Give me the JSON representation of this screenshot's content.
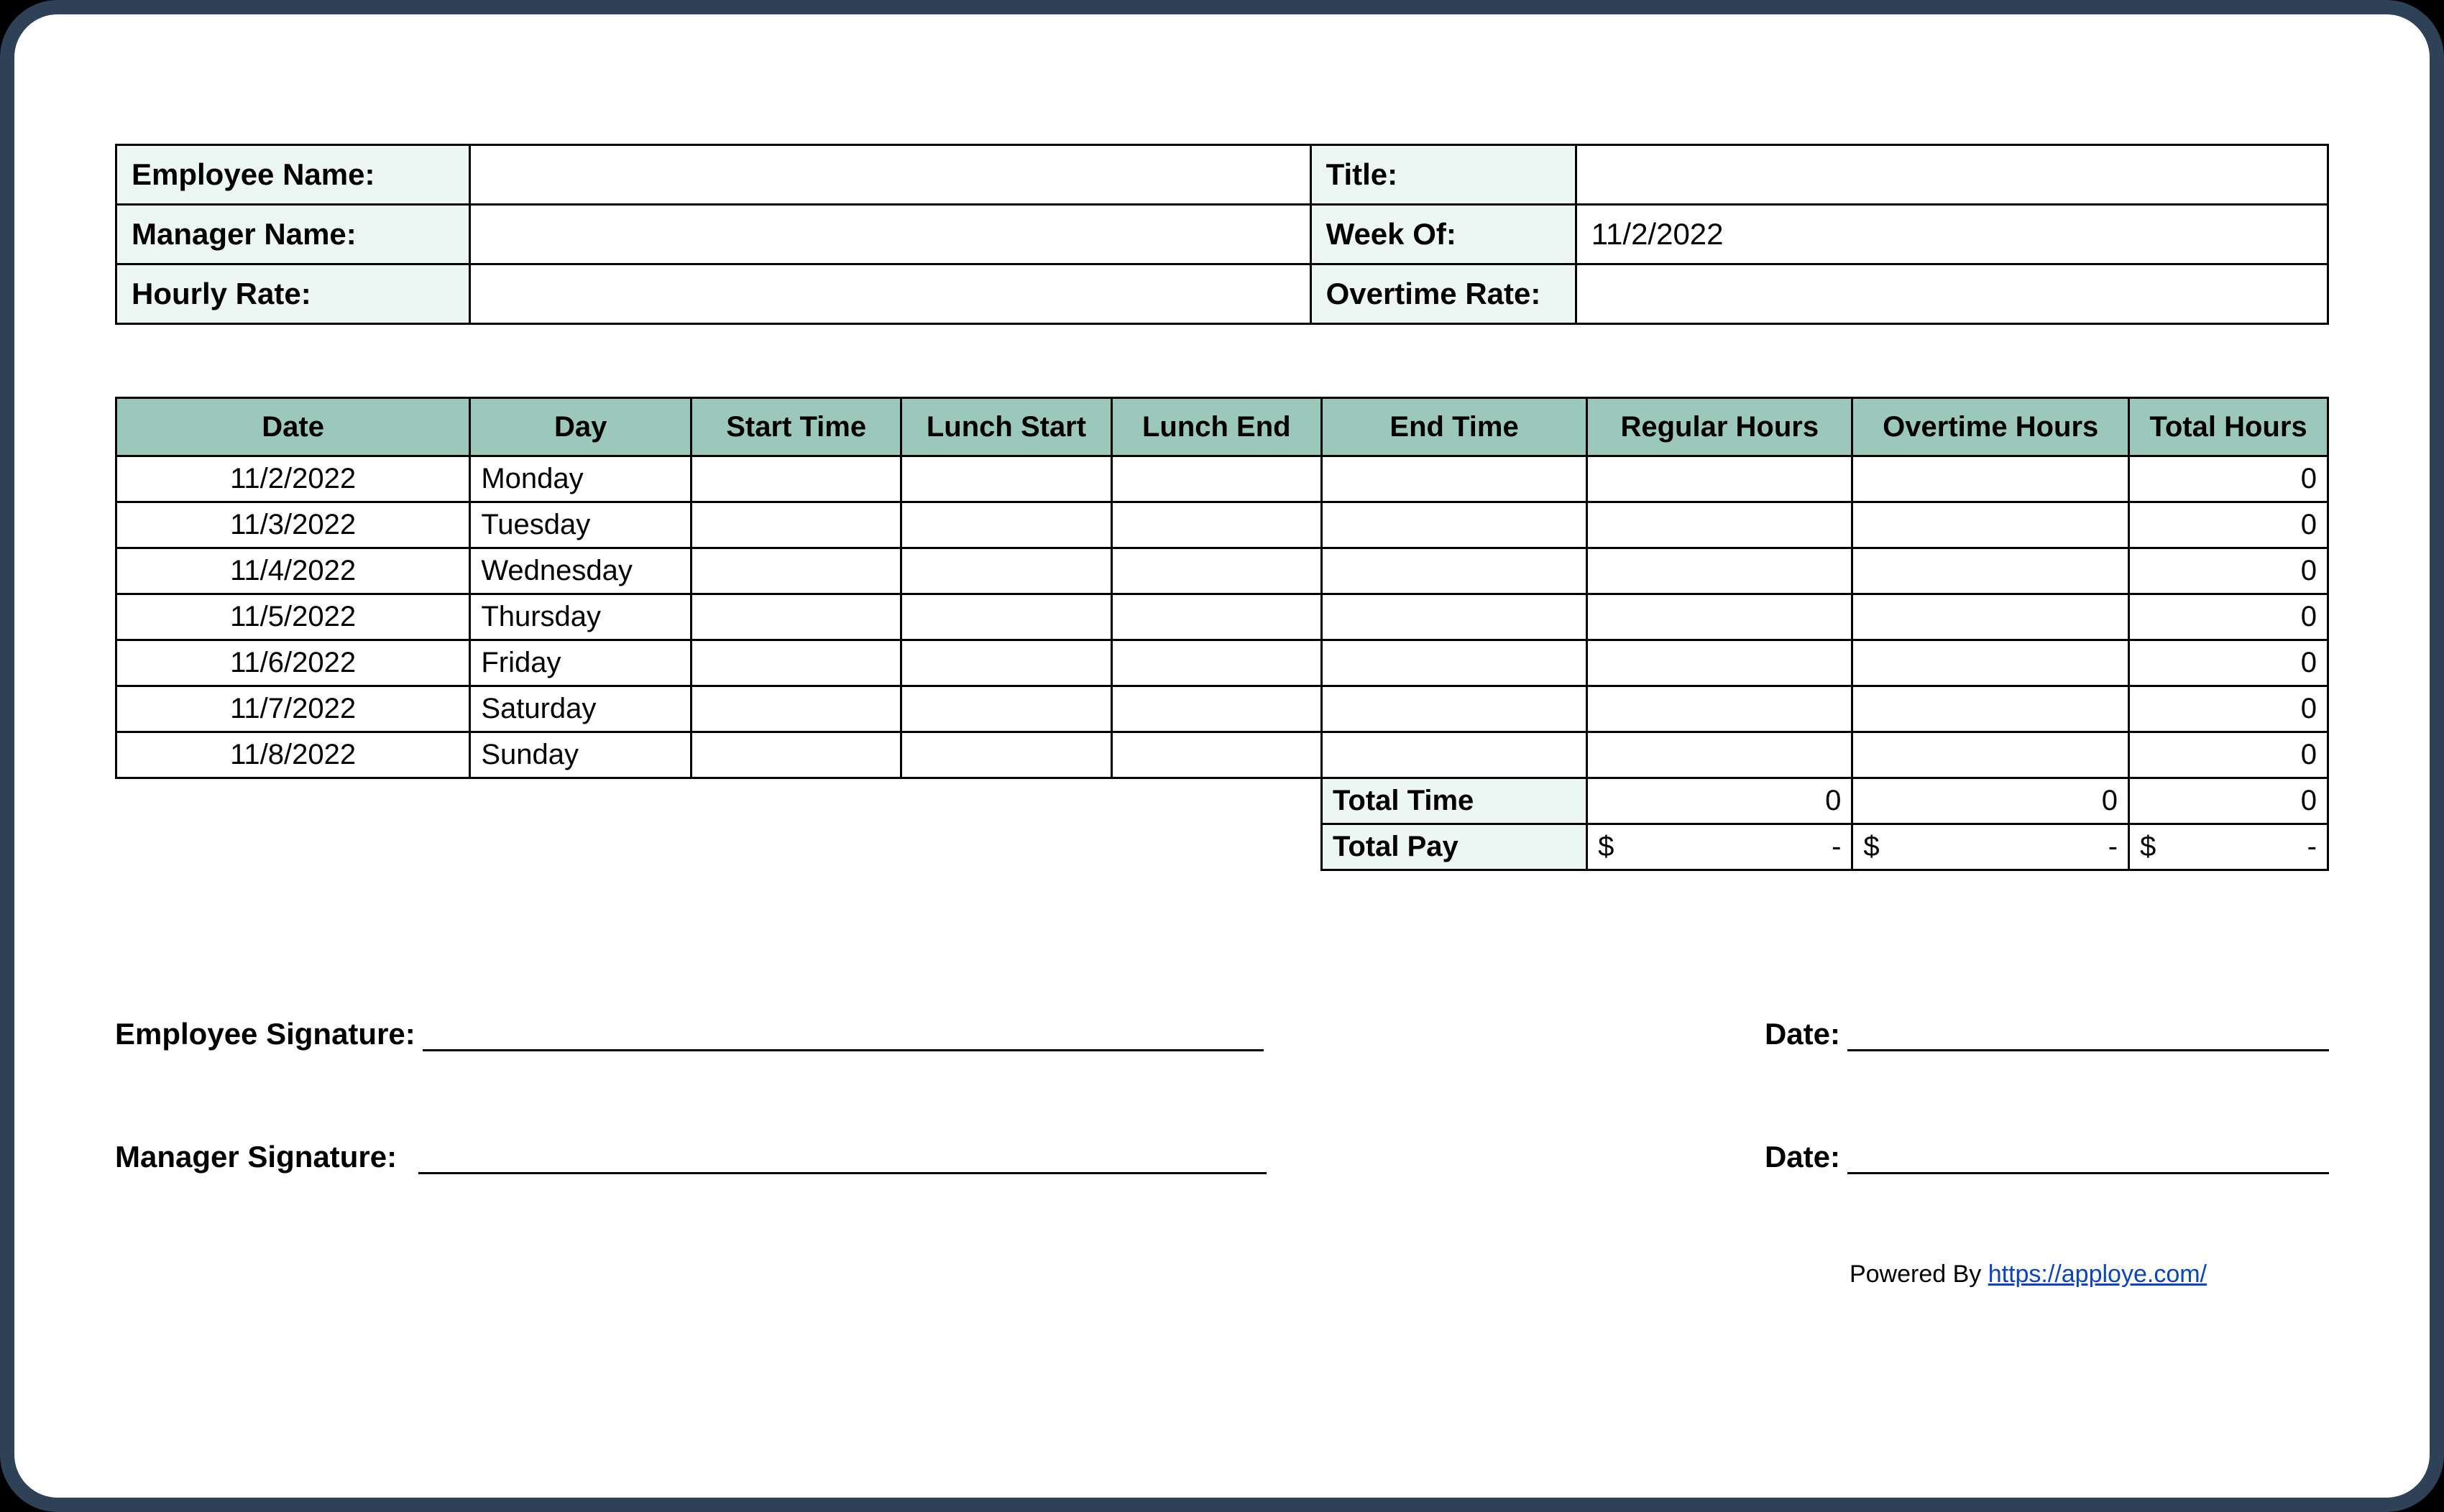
{
  "info": {
    "employee_name_label": "Employee Name:",
    "employee_name_value": "",
    "title_label": "Title:",
    "title_value": "",
    "manager_name_label": "Manager Name:",
    "manager_name_value": "",
    "week_of_label": "Week Of:",
    "week_of_value": "11/2/2022",
    "hourly_rate_label": "Hourly Rate:",
    "hourly_rate_value": "",
    "overtime_rate_label": "Overtime Rate:",
    "overtime_rate_value": ""
  },
  "columns": {
    "date": "Date",
    "day": "Day",
    "start_time": "Start Time",
    "lunch_start": "Lunch Start",
    "lunch_end": "Lunch End",
    "end_time": "End Time",
    "regular_hours": "Regular Hours",
    "overtime_hours": "Overtime Hours",
    "total_hours": "Total Hours"
  },
  "rows": [
    {
      "date": "11/2/2022",
      "day": "Monday",
      "start": "",
      "lstart": "",
      "lend": "",
      "end": "",
      "reg": "",
      "ot": "",
      "total": "0"
    },
    {
      "date": "11/3/2022",
      "day": "Tuesday",
      "start": "",
      "lstart": "",
      "lend": "",
      "end": "",
      "reg": "",
      "ot": "",
      "total": "0"
    },
    {
      "date": "11/4/2022",
      "day": "Wednesday",
      "start": "",
      "lstart": "",
      "lend": "",
      "end": "",
      "reg": "",
      "ot": "",
      "total": "0"
    },
    {
      "date": "11/5/2022",
      "day": "Thursday",
      "start": "",
      "lstart": "",
      "lend": "",
      "end": "",
      "reg": "",
      "ot": "",
      "total": "0"
    },
    {
      "date": "11/6/2022",
      "day": "Friday",
      "start": "",
      "lstart": "",
      "lend": "",
      "end": "",
      "reg": "",
      "ot": "",
      "total": "0"
    },
    {
      "date": "11/7/2022",
      "day": "Saturday",
      "start": "",
      "lstart": "",
      "lend": "",
      "end": "",
      "reg": "",
      "ot": "",
      "total": "0"
    },
    {
      "date": "11/8/2022",
      "day": "Sunday",
      "start": "",
      "lstart": "",
      "lend": "",
      "end": "",
      "reg": "",
      "ot": "",
      "total": "0"
    }
  ],
  "totals": {
    "total_time_label": "Total Time",
    "total_time_reg": "0",
    "total_time_ot": "0",
    "total_time_total": "0",
    "total_pay_label": "Total Pay",
    "pay_currency": "$",
    "pay_dash": "-"
  },
  "signatures": {
    "employee_label": "Employee Signature:",
    "manager_label": "Manager Signature:",
    "date_label": "Date:"
  },
  "powered": {
    "prefix": "Powered By ",
    "link_text": "https://apploye.com/"
  }
}
